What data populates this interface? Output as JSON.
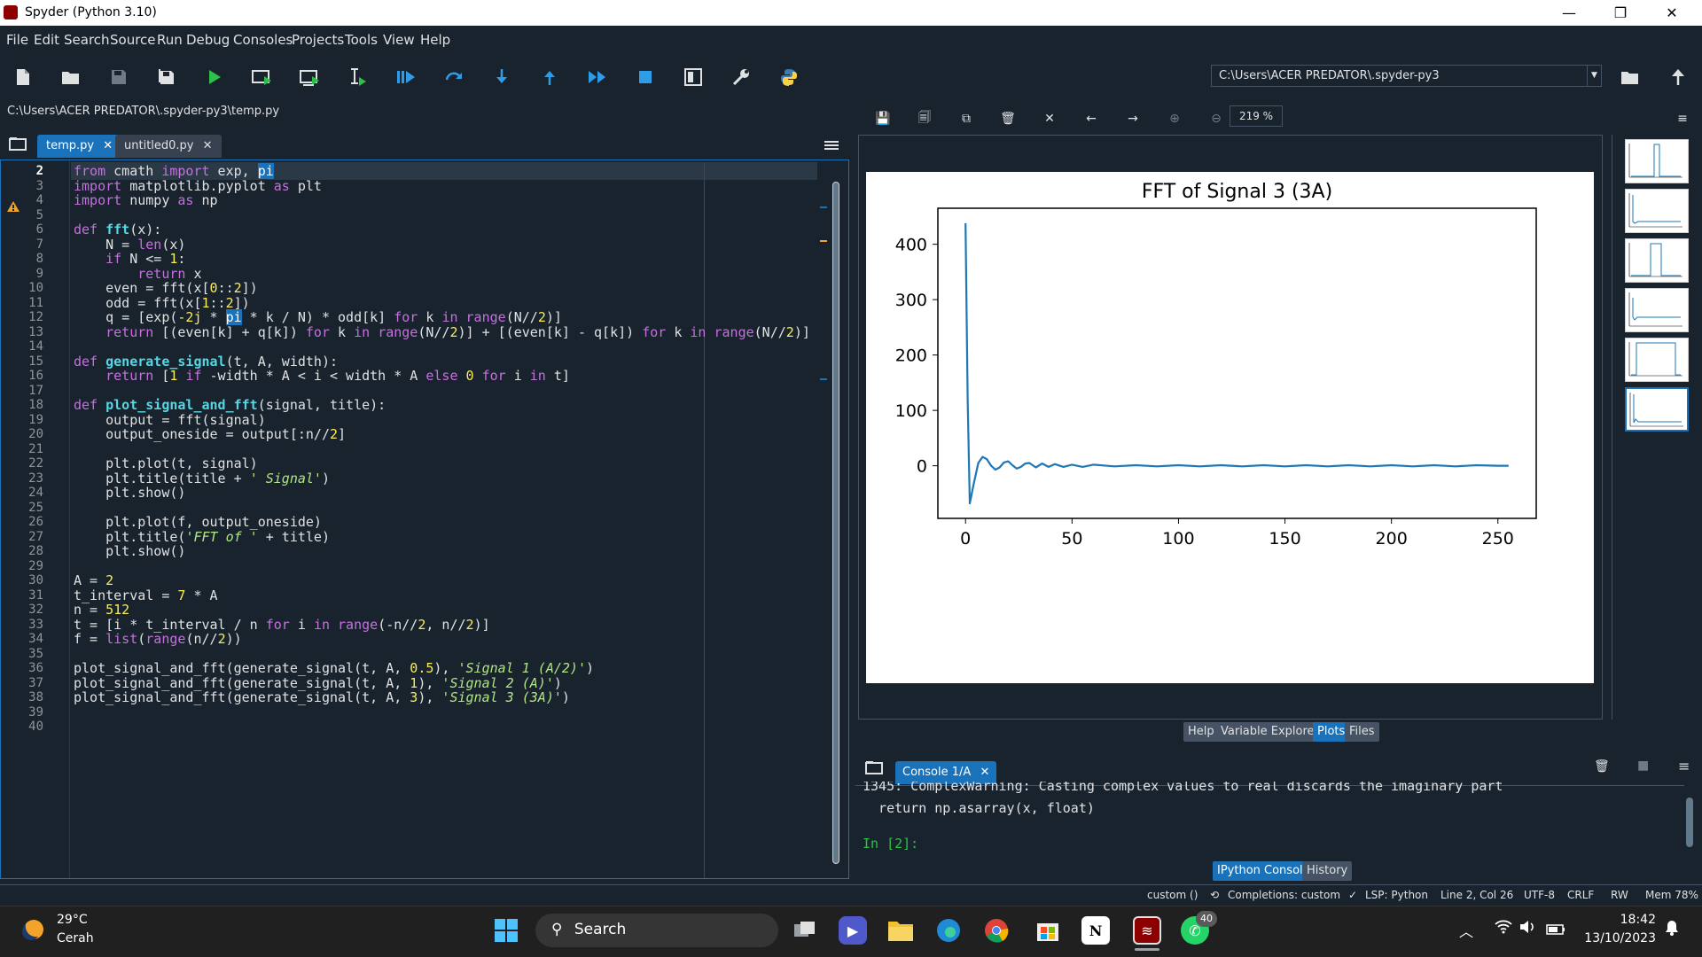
{
  "window": {
    "title": "Spyder (Python 3.10)",
    "minimize": "—",
    "restore": "❐",
    "close": "✕"
  },
  "menu": [
    "File",
    "Edit",
    "Search",
    "Source",
    "Run",
    "Debug",
    "Consoles",
    "Projects",
    "Tools",
    "View",
    "Help"
  ],
  "toolbar": {
    "working_dir": "C:\\Users\\ACER PREDATOR\\.spyder-py3"
  },
  "editor": {
    "path": "C:\\Users\\ACER PREDATOR\\.spyder-py3\\temp.py",
    "tabs": [
      {
        "label": "temp.py",
        "close": "✕"
      },
      {
        "label": "untitled0.py",
        "close": "✕"
      }
    ],
    "warning_line": "4",
    "current_line": "2",
    "line_numbers": [
      "2",
      "3",
      "4",
      "5",
      "6",
      "7",
      "8",
      "9",
      "10",
      "11",
      "12",
      "13",
      "14",
      "15",
      "16",
      "17",
      "18",
      "19",
      "20",
      "21",
      "22",
      "23",
      "24",
      "25",
      "26",
      "27",
      "28",
      "29",
      "30",
      "31",
      "32",
      "33",
      "34",
      "35",
      "36",
      "37",
      "38",
      "39",
      "40"
    ],
    "lines": [
      "from cmath import exp, pi",
      "import matplotlib.pyplot as plt",
      "import numpy as np",
      "",
      "def fft(x):",
      "    N = len(x)",
      "    if N <= 1:",
      "        return x",
      "    even = fft(x[0::2])",
      "    odd = fft(x[1::2])",
      "    q = [exp(-2j * pi * k / N) * odd[k] for k in range(N//2)]",
      "    return [(even[k] + q[k]) for k in range(N//2)] + [(even[k] - q[k]) for k in range(N//2)]",
      "",
      "def generate_signal(t, A, width):",
      "    return [1 if -width * A < i < width * A else 0 for i in t]",
      "",
      "def plot_signal_and_fft(signal, title):",
      "    output = fft(signal)",
      "    output_oneside = output[:n//2]",
      "",
      "    plt.plot(t, signal)",
      "    plt.title(title + ' Signal')",
      "    plt.show()",
      "",
      "    plt.plot(f, output_oneside)",
      "    plt.title('FFT of ' + title)",
      "    plt.show()",
      "",
      "A = 2",
      "t_interval = 7 * A",
      "n = 512",
      "t = [i * t_interval / n for i in range(-n//2, n//2)]",
      "f = list(range(n//2))",
      "",
      "plot_signal_and_fft(generate_signal(t, A, 0.5), 'Signal 1 (A/2)')",
      "plot_signal_and_fft(generate_signal(t, A, 1), 'Signal 2 (A)')",
      "plot_signal_and_fft(generate_signal(t, A, 3), 'Signal 3 (3A)')",
      "",
      ""
    ]
  },
  "plots": {
    "zoom": "219 %",
    "pane_tabs": [
      "Help",
      "Variable Explorer",
      "Plots",
      "Files"
    ],
    "selected_tab": "Plots"
  },
  "chart_data": {
    "type": "line",
    "title": "FFT of Signal 3 (3A)",
    "xlabel": "",
    "ylabel": "",
    "xlim": [
      -13,
      268
    ],
    "ylim": [
      -95,
      465
    ],
    "xticks": [
      0,
      50,
      100,
      150,
      200,
      250
    ],
    "yticks": [
      0,
      100,
      200,
      300,
      400
    ],
    "grid": false,
    "color": "#1f77b4",
    "x": [
      0,
      1,
      2,
      4,
      6,
      8,
      10,
      12,
      14,
      16,
      18,
      20,
      22,
      24,
      26,
      28,
      30,
      33,
      36,
      39,
      42,
      46,
      50,
      55,
      60,
      70,
      80,
      90,
      100,
      110,
      120,
      130,
      140,
      150,
      160,
      170,
      180,
      190,
      200,
      210,
      220,
      230,
      240,
      250,
      255
    ],
    "y": [
      438,
      120,
      -68,
      -30,
      5,
      16,
      12,
      0,
      -7,
      -3,
      6,
      8,
      1,
      -5,
      -2,
      4,
      5,
      -3,
      4,
      -2,
      3,
      -2,
      2,
      -2,
      2,
      -1,
      1,
      -1,
      1,
      -1,
      1,
      -1,
      1,
      -1,
      1,
      -1,
      1,
      -1,
      1,
      -1,
      1,
      -1,
      1,
      0,
      0
    ]
  },
  "console": {
    "tab": "Console 1/A",
    "lines": [
      "1345: ComplexWarning: Casting complex values to real discards the imaginary part",
      "  return np.asarray(x, float)"
    ],
    "prompt": "In [2]:",
    "pane_tabs": [
      "IPython Console",
      "History"
    ],
    "selected_tab": "IPython Console"
  },
  "status": {
    "env": "custom ()",
    "completions": "Completions: custom",
    "lsp": "LSP: Python",
    "position": "Line 2, Col 26",
    "encoding": "UTF-8",
    "eol": "CRLF",
    "rw": "RW",
    "mem": "Mem 78%"
  },
  "taskbar": {
    "weather_temp": "29°C",
    "weather_desc": "Cerah",
    "search": "Search",
    "whatsapp_badge": "40",
    "time": "18:42",
    "date": "13/10/2023"
  }
}
